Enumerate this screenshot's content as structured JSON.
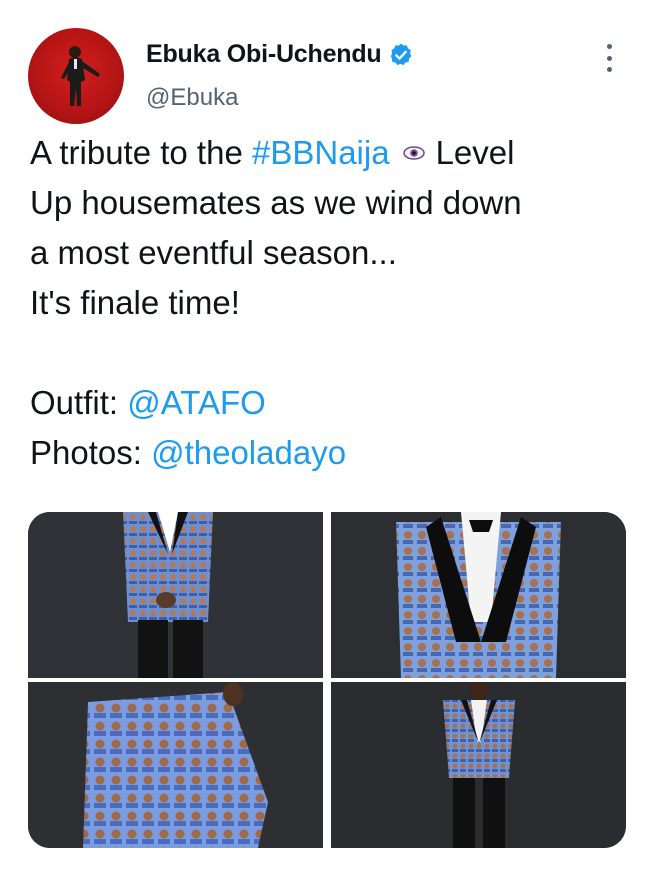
{
  "tweet": {
    "author": {
      "name": "Ebuka Obi-Uchendu",
      "handle": "@Ebuka",
      "verified": true,
      "avatar_icon": "profile-avatar"
    },
    "text_lines": [
      {
        "before": "A tribute to the ",
        "hashtag": "#BBNaija",
        "emoji": "eye-emoji",
        "after": "Level"
      },
      {
        "text": "Up housemates as we wind down"
      },
      {
        "text": "a most eventful season..."
      },
      {
        "text": "It's finale time!"
      },
      {
        "text": ""
      },
      {
        "label": "Outfit: ",
        "mention": "@ATAFO"
      },
      {
        "label": "Photos: ",
        "mention": "@theoladayo"
      }
    ],
    "media": [
      {
        "icon": "jacket-photo-front-pose"
      },
      {
        "icon": "jacket-photo-close-lapel"
      },
      {
        "icon": "jacket-photo-back"
      },
      {
        "icon": "jacket-photo-full-length"
      }
    ],
    "more_icon": "more-options-icon"
  },
  "colors": {
    "link": "#1d9bf0",
    "text": "#0f1419",
    "secondary": "#536471",
    "avatar_bg": "#c41a1a",
    "photo_bg": "#2b2d31"
  }
}
